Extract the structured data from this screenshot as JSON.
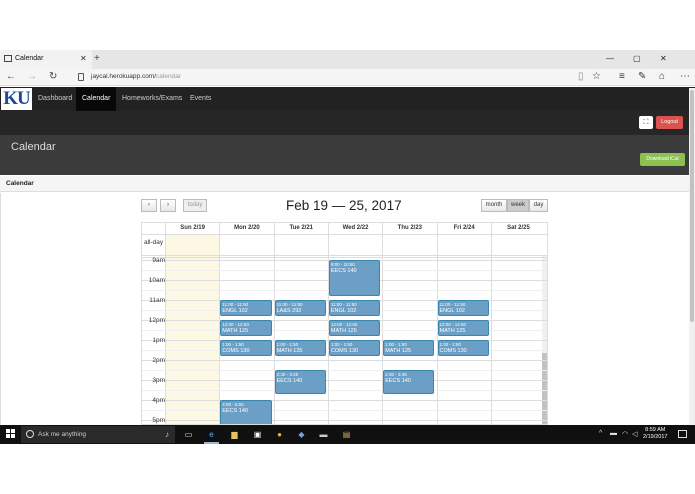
{
  "browser": {
    "tab_title": "Calendar",
    "close_glyph": "✕",
    "new_tab_glyph": "+",
    "url_host": "jaycal.herokuapp.com/",
    "url_path": "calendar",
    "window_controls": [
      "—",
      "▢",
      "✕"
    ],
    "toolbar_icons": [
      "reading-view-icon",
      "favorite-star-icon",
      "hub-icon",
      "web-note-icon",
      "share-icon",
      "more-icon"
    ]
  },
  "site": {
    "logo": "KU",
    "nav": [
      "Dashboard",
      "Calendar",
      "Homeworks/Exams",
      "Events"
    ],
    "fullscreen_glyph": "⛶",
    "logout": "Logout",
    "page_title": "Calendar",
    "download_button": "Download iCal",
    "panel_title": "Calendar"
  },
  "calendar": {
    "title": "Feb 19 — 25, 2017",
    "prev": "‹",
    "next": "›",
    "today": "today",
    "views": [
      "month",
      "week",
      "day"
    ],
    "active_view": "week",
    "days": [
      "Sun 2/19",
      "Mon 2/20",
      "Tue 2/21",
      "Wed 2/22",
      "Thu 2/23",
      "Fri 2/24",
      "Sat 2/25"
    ],
    "allday_label": "all-day",
    "hours": [
      "9am",
      "10am",
      "11am",
      "12pm",
      "1pm",
      "2pm",
      "3pm",
      "4pm",
      "5pm"
    ],
    "today_index": 0,
    "events": [
      {
        "day": 3,
        "start": 9.0,
        "end": 10.83,
        "time": "9:00 - 10:50",
        "title": "EECS 140"
      },
      {
        "day": 1,
        "start": 11.0,
        "end": 11.83,
        "time": "11:00 - 11:50",
        "title": "ENGL 102"
      },
      {
        "day": 2,
        "start": 11.0,
        "end": 11.83,
        "time": "11:00 - 11:50",
        "title": "LA&S 292"
      },
      {
        "day": 3,
        "start": 11.0,
        "end": 11.83,
        "time": "11:00 - 11:50",
        "title": "ENGL 102"
      },
      {
        "day": 5,
        "start": 11.0,
        "end": 11.83,
        "time": "11:00 - 11:50",
        "title": "ENGL 102"
      },
      {
        "day": 1,
        "start": 12.0,
        "end": 12.83,
        "time": "12:00 - 12:50",
        "title": "MATH 125"
      },
      {
        "day": 3,
        "start": 12.0,
        "end": 12.83,
        "time": "12:00 - 12:50",
        "title": "MATH 125"
      },
      {
        "day": 5,
        "start": 12.0,
        "end": 12.83,
        "time": "12:00 - 12:50",
        "title": "MATH 125"
      },
      {
        "day": 1,
        "start": 13.0,
        "end": 13.83,
        "time": "1:00 - 1:50",
        "title": "COMS 130"
      },
      {
        "day": 2,
        "start": 13.0,
        "end": 13.83,
        "time": "1:00 - 1:50",
        "title": "MATH 125"
      },
      {
        "day": 3,
        "start": 13.0,
        "end": 13.83,
        "time": "1:00 - 1:50",
        "title": "COMS 130"
      },
      {
        "day": 4,
        "start": 13.0,
        "end": 13.83,
        "time": "1:00 - 1:50",
        "title": "MATH 125"
      },
      {
        "day": 5,
        "start": 13.0,
        "end": 13.83,
        "time": "1:00 - 1:50",
        "title": "COMS 130"
      },
      {
        "day": 2,
        "start": 14.5,
        "end": 15.75,
        "time": "2:30 - 3:45",
        "title": "EECS 140"
      },
      {
        "day": 4,
        "start": 14.5,
        "end": 15.75,
        "time": "2:30 - 3:45",
        "title": "EECS 140"
      },
      {
        "day": 1,
        "start": 16.0,
        "end": 17.5,
        "time": "4:00 - 6:00",
        "title": "EECS 140"
      }
    ]
  },
  "taskbar": {
    "search_placeholder": "Ask me anything",
    "time": "8:59 AM",
    "date": "2/19/2017",
    "apps": [
      "task-view-icon",
      "edge-icon",
      "file-explorer-icon",
      "store-icon",
      "chrome-icon",
      "app-icon",
      "terminal-icon",
      "photos-icon"
    ]
  }
}
